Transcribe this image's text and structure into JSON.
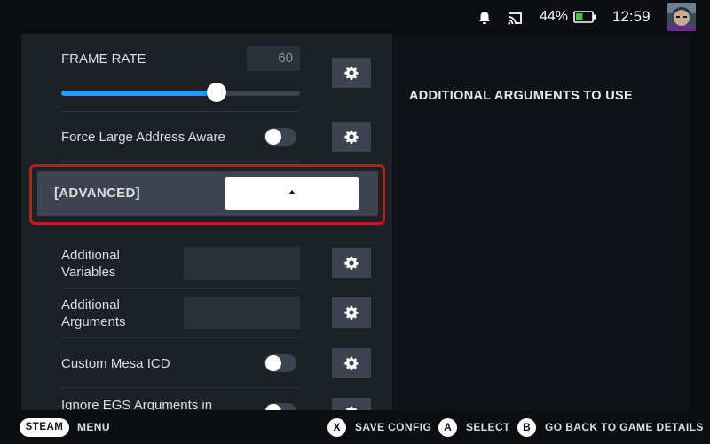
{
  "status_bar": {
    "battery_percent": "44%",
    "battery_level": 0.44,
    "time": "12:59",
    "icons": [
      "bell-icon",
      "cast-icon",
      "battery-icon",
      "avatar"
    ]
  },
  "settings": {
    "frame_rate": {
      "label": "FRAME RATE",
      "value": "60",
      "slider_fraction": 0.65
    },
    "force_large_address_aware": {
      "label": "Force Large Address Aware",
      "enabled": false
    },
    "advanced": {
      "label": "[ADVANCED]",
      "dropdown_value": ""
    },
    "additional_variables": {
      "label": "Additional Variables",
      "value": ""
    },
    "additional_arguments": {
      "label": "Additional Arguments",
      "value": ""
    },
    "custom_mesa_icd": {
      "label": "Custom Mesa ICD",
      "enabled": false
    },
    "ignore_egs_arguments": {
      "label": "Ignore EGS Arguments in",
      "enabled": false
    }
  },
  "right_panel": {
    "title": "ADDITIONAL ARGUMENTS TO USE"
  },
  "footer": {
    "steam": "STEAM",
    "menu": "MENU",
    "x_button": "X",
    "save_config": "SAVE CONFIG",
    "a_button": "A",
    "select": "SELECT",
    "b_button": "B",
    "go_back": "GO BACK TO GAME DETAILS"
  },
  "colors": {
    "accent": "#1a9fff",
    "highlight_outline": "#c8161d",
    "panel_bg": "#1c2128",
    "button_bg": "#3d4450"
  }
}
